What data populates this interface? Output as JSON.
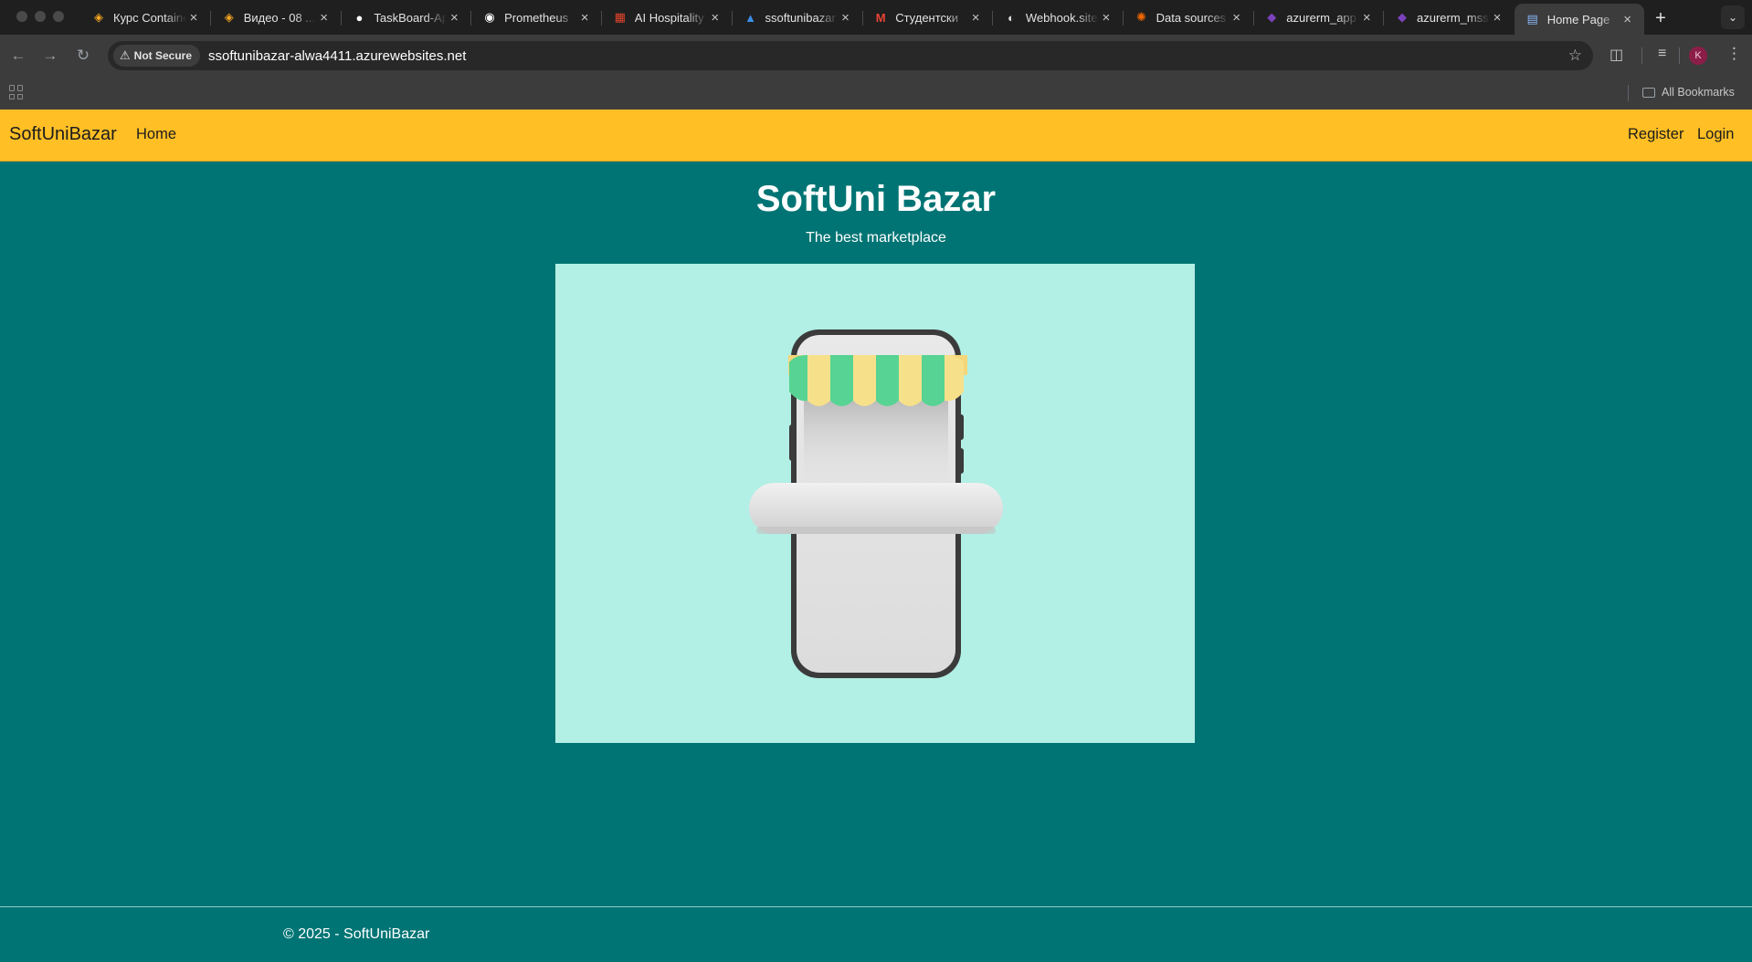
{
  "browser": {
    "tabs": [
      {
        "title": "Курс Container",
        "icon": "softuni-favicon-icon",
        "color": "#f5a623"
      },
      {
        "title": "Видео - 08 ...",
        "icon": "softuni-favicon-icon",
        "color": "#f5a623"
      },
      {
        "title": "TaskBoard-App",
        "icon": "github-icon",
        "color": "#ffffff"
      },
      {
        "title": "Prometheus",
        "icon": "prometheus-icon",
        "color": "#ffffff"
      },
      {
        "title": "AI Hospitality",
        "icon": "ai-hospitality-icon",
        "color": "#e0442c"
      },
      {
        "title": "ssoftunibazar",
        "icon": "azure-icon",
        "color": "#3b8fe8"
      },
      {
        "title": "Студентски",
        "icon": "gmail-icon",
        "color": "#ea4335"
      },
      {
        "title": "Webhook.site",
        "icon": "webhook-site-icon",
        "color": "#dddddd"
      },
      {
        "title": "Data sources",
        "icon": "grafana-icon",
        "color": "#f46800"
      },
      {
        "title": "azurerm_app",
        "icon": "terraform-icon",
        "color": "#7b42bc"
      },
      {
        "title": "azurerm_mssql",
        "icon": "terraform-icon",
        "color": "#7b42bc"
      },
      {
        "title": "Home Page",
        "icon": "document-icon",
        "color": "#8ab4f8"
      }
    ],
    "security_label": "Not Secure",
    "url": "ssoftunibazar-alwa4411.azurewebsites.net",
    "all_bookmarks_label": "All Bookmarks",
    "profile_initial": "K"
  },
  "site": {
    "brand": "SoftUniBazar",
    "nav_home": "Home",
    "nav_register": "Register",
    "nav_login": "Login",
    "hero_title": "SoftUni Bazar",
    "hero_subtitle": "The best marketplace",
    "footer": "© 2025 - SoftUniBazar",
    "colors": {
      "navbar": "#ffbf25",
      "background": "#007474",
      "image_bg": "#b2efe4"
    }
  }
}
